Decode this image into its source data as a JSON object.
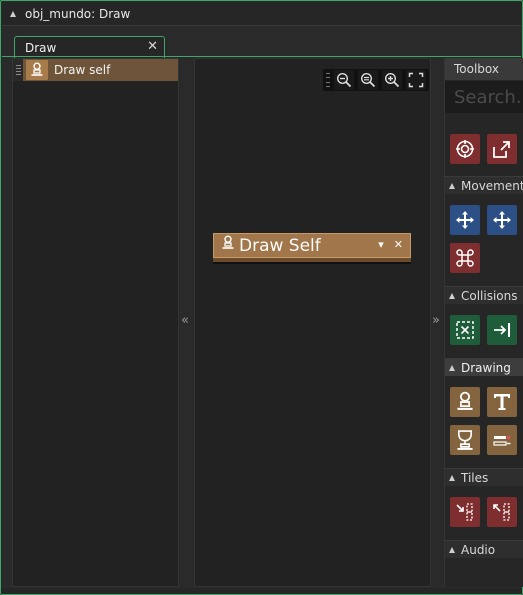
{
  "window": {
    "title": "obj_mundo: Draw"
  },
  "tab": {
    "label": "Draw",
    "close_glyph": "✕"
  },
  "events": [
    {
      "label": "Draw self",
      "icon": "draw-self-icon"
    }
  ],
  "canvas": {
    "zoom_buttons": [
      "zoom-out-icon",
      "zoom-reset-icon",
      "zoom-in-icon",
      "fit-screen-icon"
    ],
    "action": {
      "label": "Draw Self",
      "icon": "draw-self-icon",
      "menu_glyph": "▾",
      "close_glyph": "✕"
    }
  },
  "collapse": {
    "left_glyph": "«",
    "right_glyph": "»"
  },
  "toolbox": {
    "title": "Toolbox",
    "search_placeholder": "Search...",
    "sections": [
      {
        "label": "Movement"
      },
      {
        "label": "Collisions"
      },
      {
        "label": "Drawing"
      },
      {
        "label": "Tiles"
      },
      {
        "label": "Audio"
      }
    ]
  },
  "colors": {
    "accent_green": "#3fa66a",
    "event_row": "#6e5539",
    "action_block": "#a0764a",
    "red_button": "#7e2e2e",
    "blue_button": "#2c4f86",
    "green_button": "#1e5c3a",
    "brown_button": "#83643f"
  }
}
